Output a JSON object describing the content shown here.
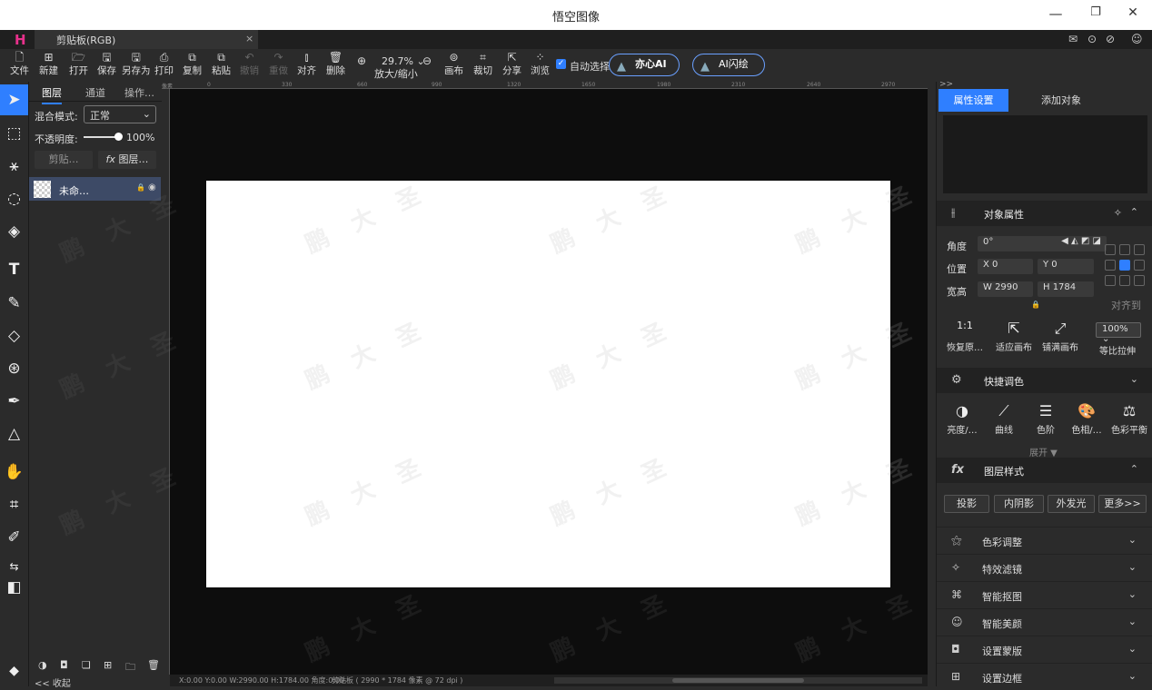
{
  "window": {
    "title": "悟空图像",
    "min": "—",
    "max": "❐",
    "close": "✕"
  },
  "tabbar": {
    "logo": "H",
    "doc_tab": "剪贴板(RGB)",
    "doc_close": "×",
    "icons": [
      "✉",
      "⊙",
      "⊘",
      "☺"
    ]
  },
  "toolbar": {
    "buttons": [
      {
        "name": "file",
        "label": "文件",
        "icon": "🗋"
      },
      {
        "name": "new",
        "label": "新建",
        "icon": "⊞"
      },
      {
        "name": "open",
        "label": "打开",
        "icon": "🗁"
      },
      {
        "name": "save",
        "label": "保存",
        "icon": "🖫"
      },
      {
        "name": "saveas",
        "label": "另存为",
        "icon": "🖫"
      },
      {
        "name": "print",
        "label": "打印",
        "icon": "⎙"
      },
      {
        "name": "copy",
        "label": "复制",
        "icon": "⧉"
      },
      {
        "name": "paste",
        "label": "粘贴",
        "icon": "⧉"
      },
      {
        "name": "undo",
        "label": "撤销",
        "icon": "↶"
      },
      {
        "name": "redo",
        "label": "重做",
        "icon": "↷"
      },
      {
        "name": "align",
        "label": "对齐",
        "icon": "⫾"
      },
      {
        "name": "delete",
        "label": "删除",
        "icon": "🗑"
      }
    ],
    "zoom_value": "29.7%",
    "zoom_label": "放大/缩小",
    "buttons2": [
      {
        "name": "canvas",
        "label": "画布",
        "icon": "⊚"
      },
      {
        "name": "crop",
        "label": "裁切",
        "icon": "⌗"
      },
      {
        "name": "share",
        "label": "分享",
        "icon": "⇱"
      },
      {
        "name": "browse",
        "label": "浏览",
        "icon": "⁘"
      }
    ],
    "auto_select": "自动选择",
    "ai1": "亦心AI",
    "ai2": "AI闪绘"
  },
  "left_panel": {
    "tabs": [
      "图层",
      "通道",
      "操作…"
    ],
    "blend_label": "混合模式:",
    "blend_value": "正常",
    "opacity_label": "不透明度:",
    "opacity_value": "100%",
    "clip_btn": "剪贴…",
    "fx_btn": "图层…",
    "layer_name": "未命…",
    "collapse": "<< 收起"
  },
  "rulers": {
    "h_ticks": [
      "像素",
      "0",
      "330",
      "660",
      "990",
      "1320",
      "1650",
      "1980",
      "2310",
      "2640",
      "2970"
    ]
  },
  "status": {
    "coords": "X:0.00 Y:0.00 W:2990.00 H:1784.00 角度:0.00",
    "doc": "剪贴板 ( 2990 * 1784 像素 @ 72 dpi )"
  },
  "right_panel": {
    "tabs": [
      "属性设置",
      "添加对象"
    ],
    "object_props": "对象属性",
    "angle_label": "角度",
    "angle_value": "0°",
    "pos_label": "位置",
    "x_value": "X  0",
    "y_value": "Y  0",
    "size_label": "宽高",
    "w_value": "W  2990",
    "h_value": "H  1784",
    "align_to": "对齐到",
    "fit_buttons": [
      {
        "name": "restore",
        "label": "恢复原…",
        "icon": "1:1"
      },
      {
        "name": "fit",
        "label": "适应画布",
        "icon": "⇱"
      },
      {
        "name": "fill",
        "label": "铺满画布",
        "icon": "⤢"
      }
    ],
    "scale_value": "100%",
    "scale_label": "等比拉伸",
    "quick_color": "快捷调色",
    "color_tools": [
      {
        "name": "brightness",
        "label": "亮度/…",
        "icon": "◑"
      },
      {
        "name": "curves",
        "label": "曲线",
        "icon": "⟋"
      },
      {
        "name": "levels",
        "label": "色阶",
        "icon": "☰"
      },
      {
        "name": "hue",
        "label": "色相/…",
        "icon": "🎨"
      },
      {
        "name": "balance",
        "label": "色彩平衡",
        "icon": "⚖"
      }
    ],
    "expand": "展开 ▼",
    "layer_style": "图层样式",
    "style_buttons": [
      "投影",
      "内阴影",
      "外发光",
      "更多>>"
    ],
    "rows": [
      {
        "name": "color-adjust",
        "label": "色彩调整",
        "icon": "⚝"
      },
      {
        "name": "effects",
        "label": "特效滤镜",
        "icon": "✧"
      },
      {
        "name": "cutout",
        "label": "智能抠图",
        "icon": "⌘"
      },
      {
        "name": "beauty",
        "label": "智能美颜",
        "icon": "☺"
      },
      {
        "name": "mask",
        "label": "设置蒙版",
        "icon": "◘"
      },
      {
        "name": "border",
        "label": "设置边框",
        "icon": "⊞"
      }
    ]
  },
  "watermark": "鹏 大 圣",
  "colors": {
    "accent": "#2f7fff",
    "canvas_bg": "#0d0d0d",
    "panel": "#2b2b2b"
  }
}
